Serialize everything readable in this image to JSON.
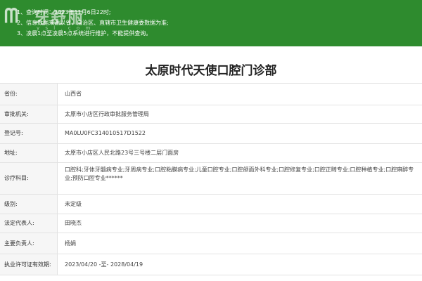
{
  "banner": {
    "notices": [
      "1、查询时间：2023年11月6日22时;",
      "2、信息数据来源以省、自治区、直辖市卫生健康委数据为准;",
      "3、凌晨1点至凌晨5点系统进行维护，不能提供查询。"
    ],
    "watermark_text": "牙舒丽",
    "watermark_sub": "y s l . c o m",
    "watermark_icon": "tooth-logo"
  },
  "title": "太原时代天使口腔门诊部",
  "fields": [
    {
      "label": "省份:",
      "value": "山西省"
    },
    {
      "label": "审批机关:",
      "value": "太原市小店区行政审批服务管理局"
    },
    {
      "label": "登记号:",
      "value": "MA0LU0FC314010517D1522"
    },
    {
      "label": "地址:",
      "value": "太原市小店区人民北路23号三号楼二层门面房"
    },
    {
      "label": "诊疗科目:",
      "value": "口腔科;牙体牙髓病专业;牙周病专业;口腔粘膜病专业;儿童口腔专业;口腔颌面外科专业;口腔修复专业;口腔正畸专业;口腔种植专业;口腔麻醉专业;预防口腔专业******"
    },
    {
      "label": "级别:",
      "value": "未定级"
    },
    {
      "label": "法定代表人:",
      "value": "田晓杰"
    },
    {
      "label": "主要负责人:",
      "value": "杨娟"
    },
    {
      "label": "执业许可证有效期:",
      "value": "2023/04/20 -至- 2028/04/19"
    }
  ],
  "colors": {
    "banner": "#2e8b2e",
    "label_bg": "#f6f6f6",
    "border": "#e2e2e2"
  }
}
